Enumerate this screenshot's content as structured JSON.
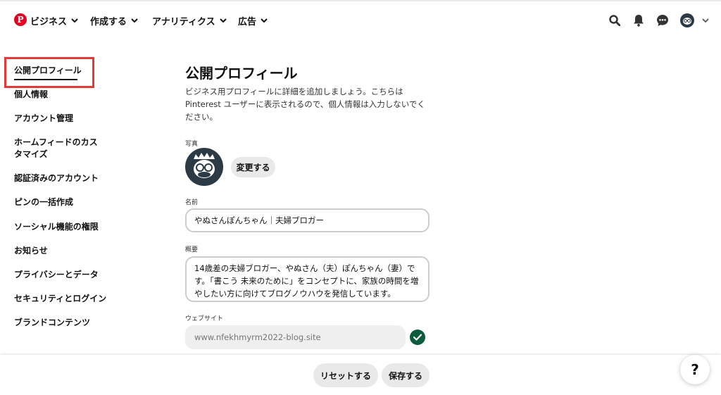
{
  "header": {
    "logo_glyph": "P",
    "brand_label": "ビジネス",
    "nav": [
      {
        "label": "作成する"
      },
      {
        "label": "アナリティクス"
      },
      {
        "label": "広告"
      }
    ],
    "icons": [
      "search-icon",
      "bell-icon",
      "chat-icon",
      "avatar",
      "chevron-down-icon"
    ]
  },
  "sidebar": {
    "items": [
      {
        "label": "公開プロフィール",
        "active": true
      },
      {
        "label": "個人情報"
      },
      {
        "label": "アカウント管理"
      },
      {
        "label": "ホームフィードのカスタマイズ"
      },
      {
        "label": "認証済みのアカウント"
      },
      {
        "label": "ピンの一括作成"
      },
      {
        "label": "ソーシャル機能の権限"
      },
      {
        "label": "お知らせ"
      },
      {
        "label": "プライバシーとデータ"
      },
      {
        "label": "セキュリティとログイン"
      },
      {
        "label": "ブランドコンテンツ"
      }
    ]
  },
  "main": {
    "title": "公開プロフィール",
    "description": "ビジネス用プロフィールに詳細を追加しましょう。こちらは Pinterest ユーザーに表示されるので、個人情報は入力しないでください。",
    "photo_label": "写真",
    "change_button": "変更する",
    "name_label": "名前",
    "name_value": "やぬさんぽんちゃん｜夫婦ブロガー",
    "about_label": "概要",
    "about_value": "14歳差の夫婦ブロガー、やぬさん（夫）ぽんちゃん（妻）です。「書こう 未来のために」をコンセプトに、家族の時間を増やしたい方に向けてブログノウハウを発信しています。",
    "website_label": "ウェブサイト",
    "website_value": "www.nfekhmyrm2022-blog.site"
  },
  "footer": {
    "reset_button": "リセットする",
    "save_button": "保存する",
    "help_label": "?"
  },
  "colors": {
    "brand": "#e60023",
    "highlight_box": "#e53935",
    "verified": "#0a5c3c"
  }
}
